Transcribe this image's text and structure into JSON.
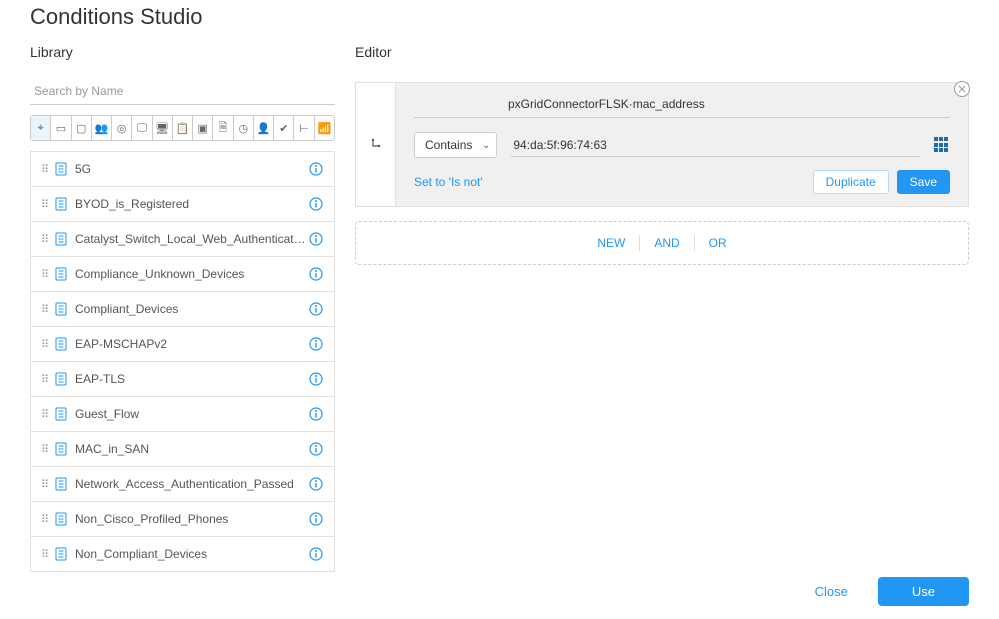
{
  "page_title": "Conditions Studio",
  "library": {
    "title": "Library",
    "search_placeholder": "Search by Name",
    "filter_icons": [
      {
        "name": "location-pin-icon",
        "glyph": "⌖",
        "active": true
      },
      {
        "name": "device-icon",
        "glyph": "▭"
      },
      {
        "name": "screen-icon",
        "glyph": "▢"
      },
      {
        "name": "group-icon",
        "glyph": "👥"
      },
      {
        "name": "target-icon",
        "glyph": "◎"
      },
      {
        "name": "monitor-icon",
        "glyph": "🖵"
      },
      {
        "name": "desktop-icon",
        "glyph": "🖥"
      },
      {
        "name": "clipboard-icon",
        "glyph": "📋"
      },
      {
        "name": "badge-icon",
        "glyph": "▣"
      },
      {
        "name": "file-icon",
        "glyph": "🗎"
      },
      {
        "name": "clock-icon",
        "glyph": "◷"
      },
      {
        "name": "user-icon",
        "glyph": "👤"
      },
      {
        "name": "check-circle-icon",
        "glyph": "✔"
      },
      {
        "name": "hierarchy-icon",
        "glyph": "⊢"
      },
      {
        "name": "wifi-icon",
        "glyph": "📶"
      }
    ],
    "items": [
      {
        "label": "5G"
      },
      {
        "label": "BYOD_is_Registered"
      },
      {
        "label": "Catalyst_Switch_Local_Web_Authentication"
      },
      {
        "label": "Compliance_Unknown_Devices"
      },
      {
        "label": "Compliant_Devices"
      },
      {
        "label": "EAP-MSCHAPv2"
      },
      {
        "label": "EAP-TLS"
      },
      {
        "label": "Guest_Flow"
      },
      {
        "label": "MAC_in_SAN"
      },
      {
        "label": "Network_Access_Authentication_Passed"
      },
      {
        "label": "Non_Cisco_Profiled_Phones"
      },
      {
        "label": "Non_Compliant_Devices"
      }
    ]
  },
  "editor": {
    "title": "Editor",
    "attribute": "pxGridConnectorFLSK·mac_address",
    "operator": "Contains",
    "value": "94:da:5f:96:74:63",
    "set_isnot": "Set to 'Is not'",
    "duplicate": "Duplicate",
    "save": "Save",
    "logic": {
      "new": "NEW",
      "and": "AND",
      "or": "OR"
    }
  },
  "footer": {
    "close": "Close",
    "use": "Use"
  }
}
